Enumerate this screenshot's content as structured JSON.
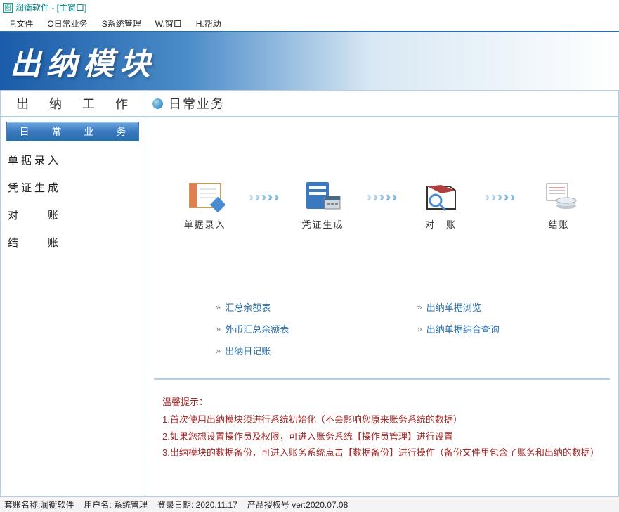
{
  "window": {
    "title": "润衡软件 - [主窗口]"
  },
  "menubar": [
    "F.文件",
    "O日常业务",
    "S系统管理",
    "W.窗口",
    "H.帮助"
  ],
  "banner": "出纳模块",
  "sidebar": {
    "header": "出 纳 工 作",
    "category_label": "日 常 业 务",
    "items": [
      "单据录入",
      "凭证生成",
      "对　　账",
      "结　　账"
    ]
  },
  "main": {
    "title": "日常业务",
    "flow": [
      "单据录入",
      "凭证生成",
      "对　账",
      "结账"
    ],
    "links": [
      "汇总余额表",
      "出纳单据浏览",
      "外币汇总余额表",
      "出纳单据综合查询",
      "出纳日记账"
    ],
    "tips_title": "温馨提示：",
    "tips": [
      "1.首次使用出纳模块须进行系统初始化（不会影响您原来账务系统的数据）",
      "2.如果您想设置操作员及权限，可进入账务系统【操作员管理】进行设置",
      "3.出纳模块的数据备份，可进入账务系统点击【数据备份】进行操作（备份文件里包含了账务和出纳的数据）"
    ]
  },
  "status": {
    "acct": "套账名称:润衡软件",
    "user": "用户名: 系统管理",
    "login": "登录日期: 2020.11.17",
    "lic": "产品授权号  ver:2020.07.08"
  }
}
